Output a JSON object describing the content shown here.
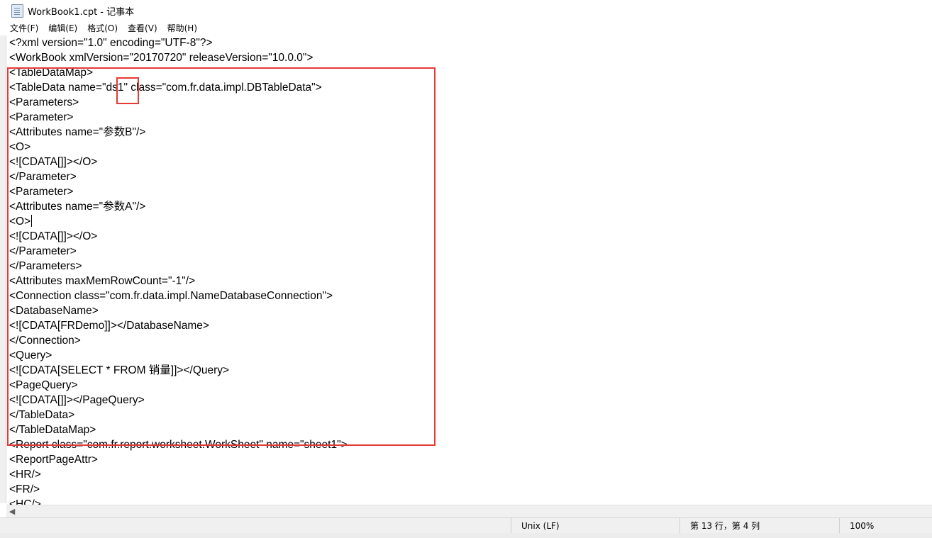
{
  "window": {
    "title": "WorkBook1.cpt - 记事本",
    "app_icon": "notepad-icon"
  },
  "menu": [
    "文件(F)",
    "编辑(E)",
    "格式(O)",
    "查看(V)",
    "帮助(H)"
  ],
  "lines": [
    "<?xml version=\"1.0\" encoding=\"UTF-8\"?>",
    "<WorkBook xmlVersion=\"20170720\" releaseVersion=\"10.0.0\">",
    "<TableDataMap>",
    "<TableData name=\"ds1\" class=\"com.fr.data.impl.DBTableData\">",
    "<Parameters>",
    "<Parameter>",
    "<Attributes name=\"参数B\"/>",
    "<O>",
    "<![CDATA[]]></O>",
    "</Parameter>",
    "<Parameter>",
    "<Attributes name=\"参数A\"/>",
    "<O>",
    "<![CDATA[]]></O>",
    "</Parameter>",
    "</Parameters>",
    "<Attributes maxMemRowCount=\"-1\"/>",
    "<Connection class=\"com.fr.data.impl.NameDatabaseConnection\">",
    "<DatabaseName>",
    "<![CDATA[FRDemo]]></DatabaseName>",
    "</Connection>",
    "<Query>",
    "<![CDATA[SELECT * FROM 销量]]></Query>",
    "<PageQuery>",
    "<![CDATA[]]></PageQuery>",
    "</TableData>",
    "</TableDataMap>",
    "<Report class=\"com.fr.report.worksheet.WorkSheet\" name=\"sheet1\">",
    "<ReportPageAttr>",
    "<HR/>",
    "<FR/>",
    "<HC/>"
  ],
  "status": {
    "line_ending": "Unix (LF)",
    "position": "第 13 行，第 4 列",
    "zoom": "100%"
  },
  "colors": {
    "highlight": "#e53935"
  }
}
